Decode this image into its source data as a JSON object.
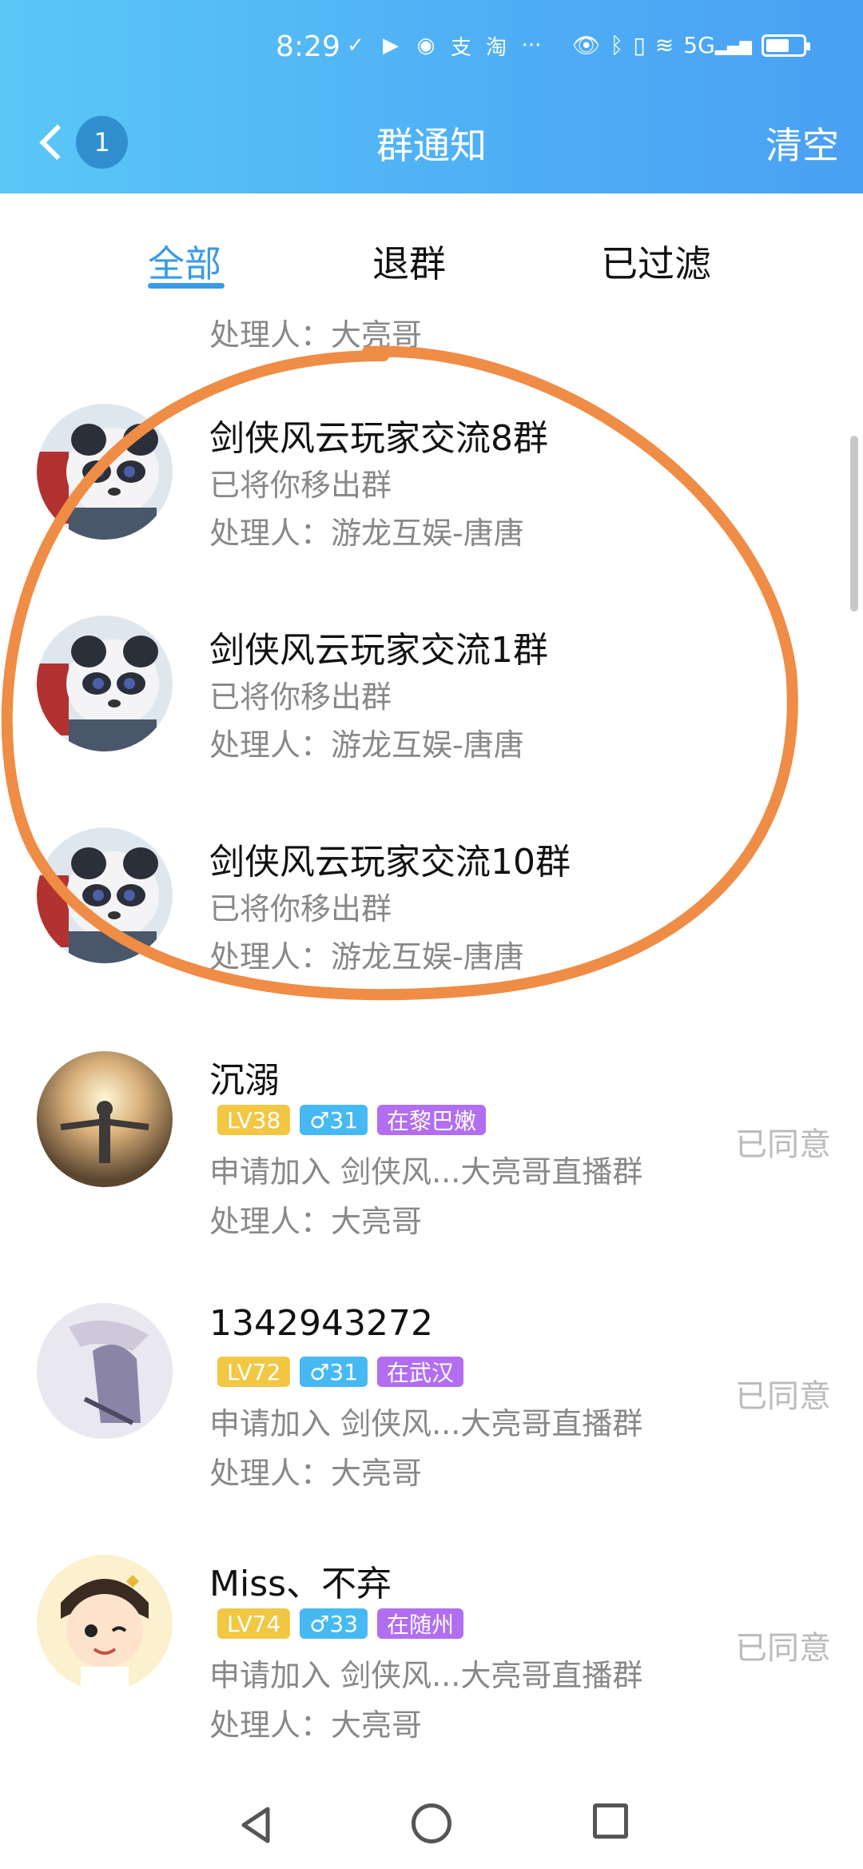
{
  "status_bar": {
    "time": "8:29",
    "network": "5G"
  },
  "header": {
    "title": "群通知",
    "back_badge": "1",
    "clear_label": "清空"
  },
  "tabs": [
    {
      "label": "全部",
      "active": true
    },
    {
      "label": "退群",
      "active": false
    },
    {
      "label": "已过滤",
      "active": false
    }
  ],
  "partial_top_item": {
    "handler": "处理人：大亮哥"
  },
  "items": [
    {
      "avatar": "panda-avatar",
      "name": "剑侠风云玩家交流8群",
      "line1": "已将你移出群",
      "line2": "处理人：游龙互娱-唐唐"
    },
    {
      "avatar": "panda-avatar",
      "name": "剑侠风云玩家交流1群",
      "line1": "已将你移出群",
      "line2": "处理人：游龙互娱-唐唐"
    },
    {
      "avatar": "panda-avatar",
      "name": "剑侠风云玩家交流10群",
      "line1": "已将你移出群",
      "line2": "处理人：游龙互娱-唐唐"
    },
    {
      "avatar": "photo-avatar",
      "name": "沉溺",
      "tags": [
        "LV38",
        "♂31",
        "在黎巴嫩"
      ],
      "line1": "申请加入 剑侠风...大亮哥直播群",
      "line2": "处理人：大亮哥",
      "status": "已同意"
    },
    {
      "avatar": "anime-avatar",
      "name": "1342943272",
      "tags": [
        "LV72",
        "♂31",
        "在武汉"
      ],
      "line1": "申请加入 剑侠风...大亮哥直播群",
      "line2": "处理人：大亮哥",
      "status": "已同意"
    },
    {
      "avatar": "cartoon-avatar",
      "name": "Miss、不弃",
      "tags": [
        "LV74",
        "♂33",
        "在随州"
      ],
      "line1": "申请加入 剑侠风...大亮哥直播群",
      "line2": "处理人：大亮哥",
      "status": "已同意"
    }
  ],
  "colors": {
    "header_start": "#5bc7f7",
    "header_end": "#4aa0f3",
    "accent": "#3b9ae6",
    "annotation": "#ef8c45",
    "tag_level": "#f2c744",
    "tag_gender": "#47b9f2",
    "tag_location": "#b16ef0"
  }
}
